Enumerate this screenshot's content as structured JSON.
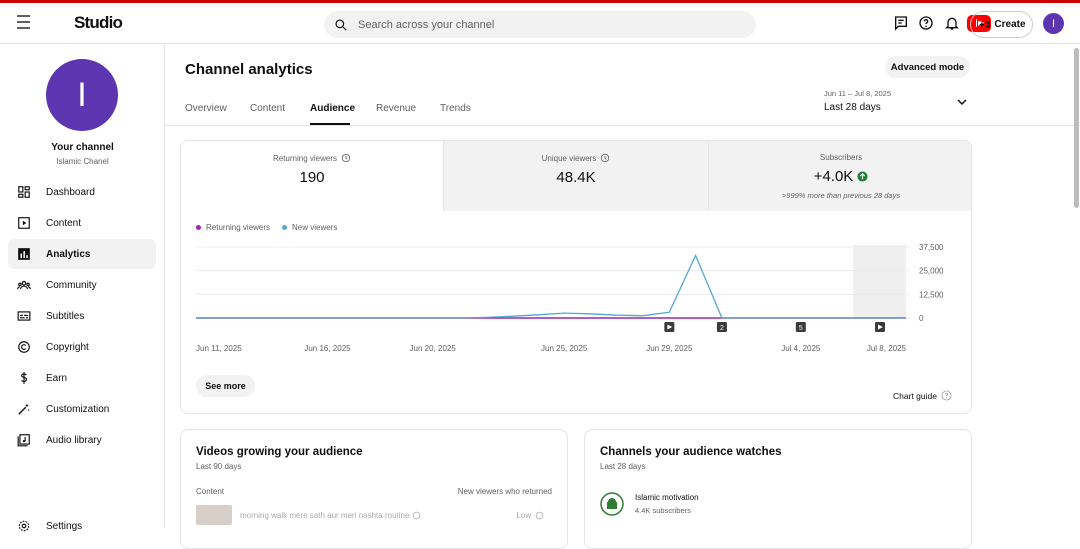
{
  "header": {
    "app_name": "Studio",
    "search_placeholder": "Search across your channel",
    "create_label": "Create",
    "avatar_letter": "I"
  },
  "sidebar": {
    "avatar_letter": "I",
    "your_channel": "Your channel",
    "channel_name": "Islamic Chanel",
    "items": [
      {
        "label": "Dashboard",
        "icon": "dashboard-icon"
      },
      {
        "label": "Content",
        "icon": "content-icon"
      },
      {
        "label": "Analytics",
        "icon": "analytics-icon",
        "active": true
      },
      {
        "label": "Community",
        "icon": "community-icon"
      },
      {
        "label": "Subtitles",
        "icon": "subtitles-icon"
      },
      {
        "label": "Copyright",
        "icon": "copyright-icon"
      },
      {
        "label": "Earn",
        "icon": "earn-icon"
      },
      {
        "label": "Customization",
        "icon": "customization-icon"
      },
      {
        "label": "Audio library",
        "icon": "audio-library-icon"
      },
      {
        "label": "Settings",
        "icon": "settings-icon"
      }
    ]
  },
  "main": {
    "title": "Channel analytics",
    "advanced_mode": "Advanced mode",
    "tabs": [
      "Overview",
      "Content",
      "Audience",
      "Revenue",
      "Trends"
    ],
    "active_tab": "Audience",
    "date_range": "Jun 11 – Jul 8, 2025",
    "date_label": "Last 28 days"
  },
  "metrics": [
    {
      "label": "Returning viewers",
      "value": "190"
    },
    {
      "label": "Unique viewers",
      "value": "48.4K"
    },
    {
      "label": "Subscribers",
      "value": "+4.0K",
      "sub": ">999% more than previous 28 days"
    }
  ],
  "legend": {
    "returning": "Returning viewers",
    "new": "New viewers"
  },
  "see_more": "See more",
  "chart_guide": "Chart guide",
  "chart_data": {
    "type": "line",
    "x": [
      "Jun 11, 2025",
      "Jun 12",
      "Jun 13",
      "Jun 14",
      "Jun 15",
      "Jun 16, 2025",
      "Jun 17",
      "Jun 18",
      "Jun 19",
      "Jun 20, 2025",
      "Jun 21",
      "Jun 22",
      "Jun 23",
      "Jun 24",
      "Jun 25, 2025",
      "Jun 26",
      "Jun 27",
      "Jun 28",
      "Jun 29, 2025",
      "Jun 30",
      "Jul 1",
      "Jul 2",
      "Jul 3",
      "Jul 4, 2025",
      "Jul 5",
      "Jul 6",
      "Jul 7",
      "Jul 8, 2025"
    ],
    "xticks": [
      "Jun 11, 2025",
      "Jun 16, 2025",
      "Jun 20, 2025",
      "Jun 25, 2025",
      "Jun 29, 2025",
      "Jul 4, 2025",
      "Jul 8, 2025"
    ],
    "yticks": [
      "37,500",
      "25,000",
      "12,500",
      "0"
    ],
    "ylim": [
      0,
      37500
    ],
    "series": [
      {
        "name": "Returning viewers",
        "color": "#9c27b0",
        "values": [
          0,
          0,
          0,
          0,
          0,
          0,
          0,
          0,
          0,
          0,
          0,
          0,
          0,
          0,
          0,
          0,
          0,
          0,
          0,
          0,
          0,
          0,
          0,
          0,
          0,
          0,
          0,
          0
        ]
      },
      {
        "name": "New viewers",
        "color": "#55a8d0",
        "values": [
          0,
          0,
          0,
          0,
          0,
          0,
          0,
          0,
          0,
          0,
          0,
          300,
          900,
          1700,
          2600,
          2200,
          1500,
          1200,
          3000,
          33000,
          0,
          0,
          0,
          0,
          0,
          0,
          0,
          0
        ]
      }
    ],
    "markers": [
      {
        "date": "Jun 29, 2025",
        "icon": "play-icon"
      },
      {
        "date": "Jul 1",
        "label": "2"
      },
      {
        "date": "Jul 4, 2025",
        "label": "5"
      },
      {
        "date": "Jul 8, 2025",
        "icon": "play-icon"
      }
    ]
  },
  "growing": {
    "title": "Videos growing your audience",
    "sub": "Last 90 days",
    "col_content": "Content",
    "col_new": "New viewers who returned",
    "row_title": "morning walk mere sath aur meri nashta routine",
    "row_value": "Low"
  },
  "channels": {
    "title": "Channels your audience watches",
    "sub": "Last 28 days",
    "item_name": "Islamic motivation",
    "item_subs": "4.4K subscribers"
  }
}
